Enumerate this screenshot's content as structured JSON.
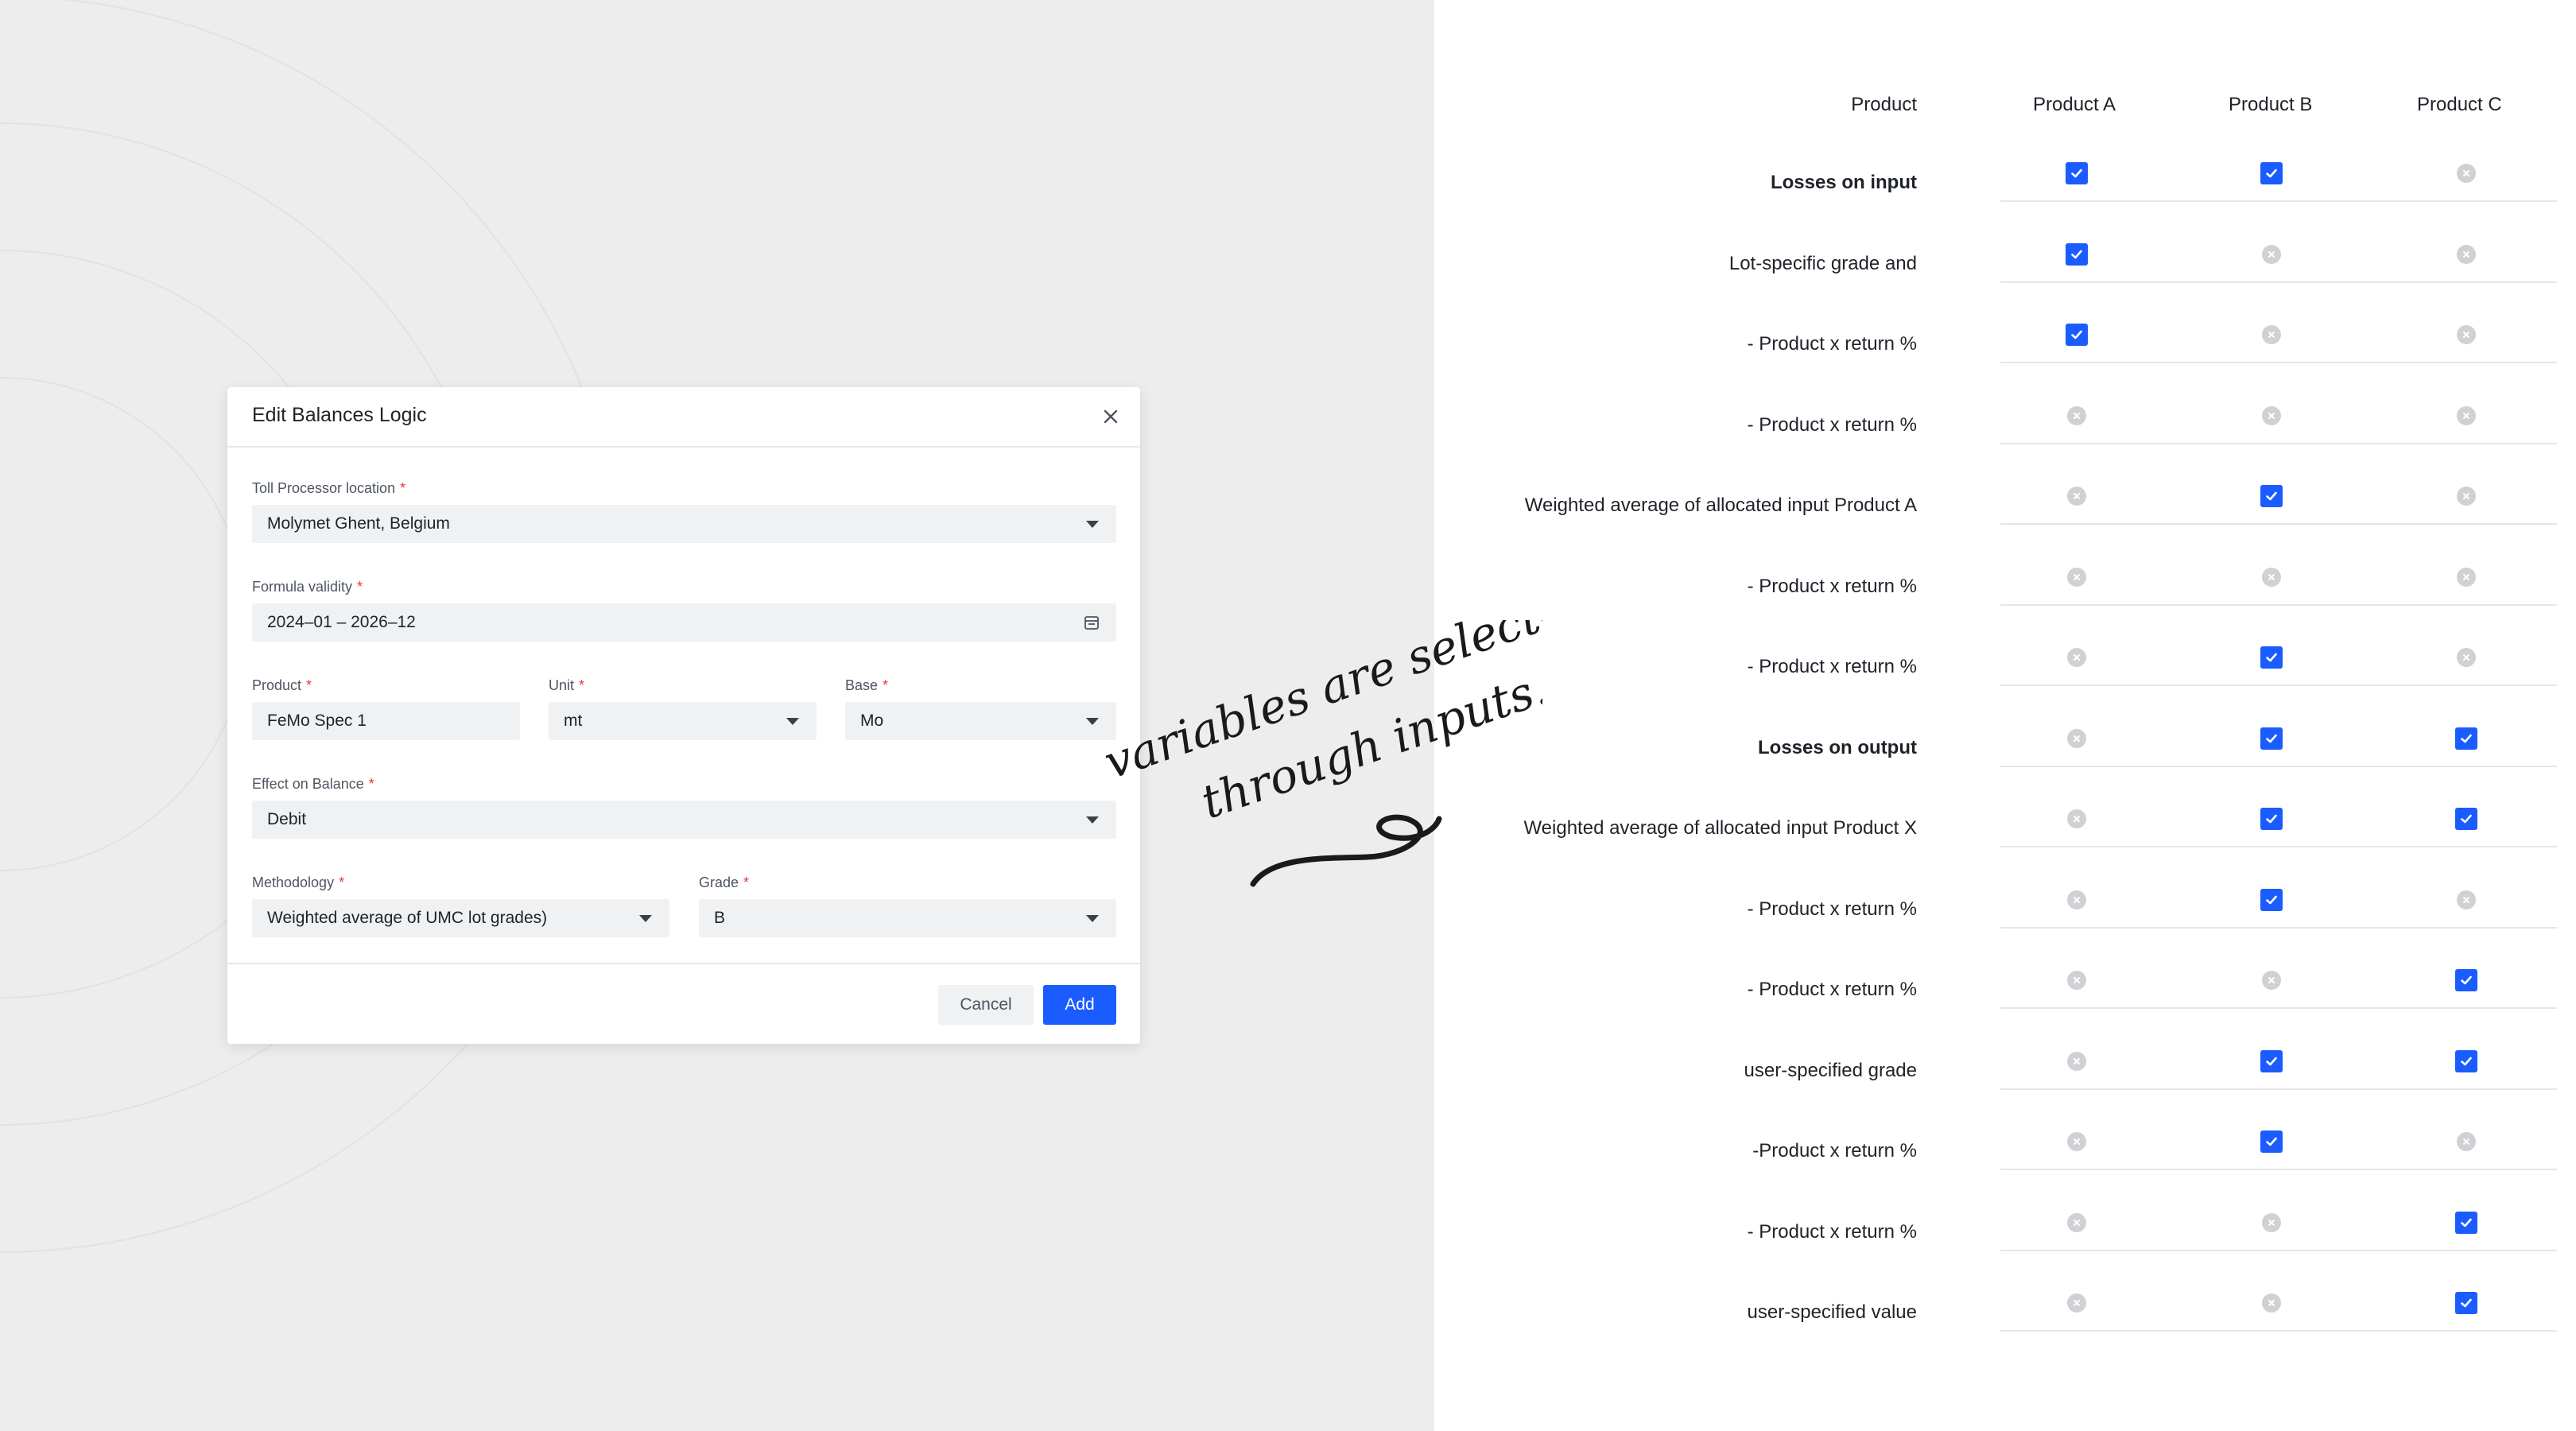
{
  "modal": {
    "title": "Edit Balances Logic",
    "toll_processor": {
      "label": "Toll Processor location",
      "required": "*",
      "value": "Molymet Ghent, Belgium"
    },
    "formula_validity": {
      "label": "Formula validity",
      "required": "*",
      "value": "2024–01 – 2026–12"
    },
    "product": {
      "label": "Product",
      "required": "*",
      "value": "FeMo Spec 1"
    },
    "unit": {
      "label": "Unit",
      "required": "*",
      "value": "mt"
    },
    "base": {
      "label": "Base",
      "required": "*",
      "value": "Mo"
    },
    "effect_on_balance": {
      "label": "Effect on Balance",
      "required": "*",
      "value": "Debit"
    },
    "methodology": {
      "label": "Methodology",
      "required": "*",
      "value": "Weighted average of UMC lot grades)"
    },
    "grade": {
      "label": "Grade",
      "required": "*",
      "value": "B"
    },
    "cancel_label": "Cancel",
    "add_label": "Add"
  },
  "annotation": {
    "line1": "variables are selected",
    "line2": "through inputs."
  },
  "table": {
    "header_label": "Product",
    "columns": [
      "Product A",
      "Product B",
      "Product C"
    ],
    "rows": [
      {
        "label": "Losses on input",
        "bold": true,
        "values": [
          true,
          true,
          false
        ]
      },
      {
        "label": "Lot-specific grade and",
        "bold": false,
        "values": [
          true,
          false,
          false
        ]
      },
      {
        "label": "- Product x return %",
        "bold": false,
        "values": [
          true,
          false,
          false
        ]
      },
      {
        "label": "- Product x return %",
        "bold": false,
        "values": [
          false,
          false,
          false
        ]
      },
      {
        "label": "Weighted average of allocated input Product A",
        "bold": false,
        "values": [
          false,
          true,
          false
        ]
      },
      {
        "label": "- Product x return %",
        "bold": false,
        "values": [
          false,
          false,
          false
        ]
      },
      {
        "label": "- Product x return %",
        "bold": false,
        "values": [
          false,
          true,
          false
        ]
      },
      {
        "label": "Losses on output",
        "bold": true,
        "values": [
          false,
          true,
          true
        ]
      },
      {
        "label": "Weighted average of allocated input Product X",
        "bold": false,
        "values": [
          false,
          true,
          true
        ]
      },
      {
        "label": "- Product x return %",
        "bold": false,
        "values": [
          false,
          true,
          false
        ]
      },
      {
        "label": "- Product x return %",
        "bold": false,
        "values": [
          false,
          false,
          true
        ]
      },
      {
        "label": "user-specified grade",
        "bold": false,
        "values": [
          false,
          true,
          true
        ]
      },
      {
        "label": "-Product x return %",
        "bold": false,
        "values": [
          false,
          true,
          false
        ]
      },
      {
        "label": "- Product x return %",
        "bold": false,
        "values": [
          false,
          false,
          true
        ]
      },
      {
        "label": "user-specified value",
        "bold": false,
        "values": [
          false,
          false,
          true
        ]
      }
    ]
  },
  "colors": {
    "accent": "#1a5cff",
    "required": "#e5383b",
    "unchecked": "#cfd1d4"
  },
  "icons": {
    "close": "close-icon",
    "caret": "chevron-down-icon",
    "calendar": "calendar-icon",
    "check": "checkmark-icon",
    "unchecked": "x-circle-icon"
  }
}
